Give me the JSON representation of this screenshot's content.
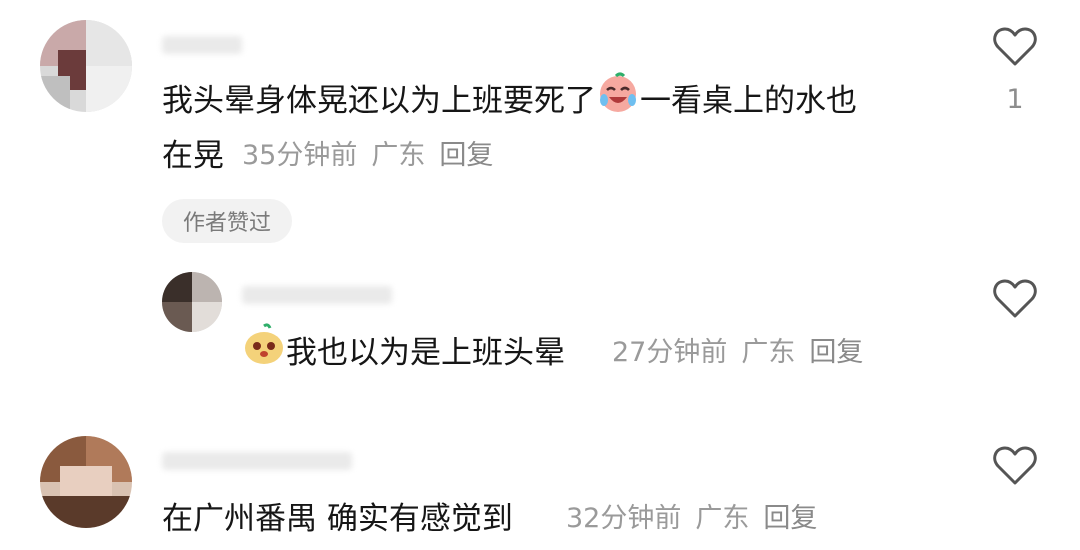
{
  "comments": [
    {
      "text_line1_part1": "我头晕身体晃还以为上班要死了",
      "emoji_1": "crying-laughing-face-emoji",
      "text_line1_part2": "一看桌上的水也",
      "text_line2": "在晃",
      "time": "35分钟前",
      "location": "广东",
      "reply_label": "回复",
      "author_liked_badge": "作者赞过",
      "like_count": "1",
      "like_icon": "heart-outline-icon"
    },
    {
      "emoji_1": "cute-blob-emoji",
      "text": "我也以为是上班头晕",
      "time": "27分钟前",
      "location": "广东",
      "reply_label": "回复",
      "like_icon": "heart-outline-icon"
    },
    {
      "text": "在广州番禺 确实有感觉到",
      "time": "32分钟前",
      "location": "广东",
      "reply_label": "回复",
      "like_icon": "heart-outline-icon"
    }
  ],
  "colors": {
    "text_primary": "#161616",
    "text_meta": "#9a9a9a",
    "badge_bg": "#f2f2f2",
    "icon_stroke": "#555555"
  }
}
